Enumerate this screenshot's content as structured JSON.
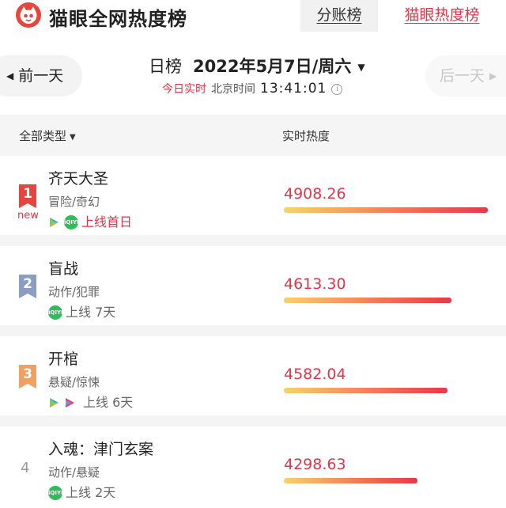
{
  "header": {
    "brand": "猫眼全网热度榜",
    "tabs": [
      {
        "label": "分账榜",
        "active": false
      },
      {
        "label": "猫眼热度榜",
        "active": true
      }
    ]
  },
  "date_nav": {
    "prev_label": "前一天",
    "next_label": "后一天",
    "board_label": "日榜",
    "date": "2022年5月7日/周六",
    "live_label": "今日实时",
    "tz_label": "北京时间",
    "time": "13:41:01"
  },
  "columns": {
    "type_filter": "全部类型",
    "heat_label": "实时热度"
  },
  "colors": {
    "accent": "#e3354b",
    "bar_start": "#f7d36a",
    "bar_end": "#e5394b",
    "iqiyi_green": "#2fbd5a"
  },
  "rows": [
    {
      "rank": "1",
      "badge": "new",
      "title": "齐天大圣",
      "genre": "冒险/奇幻",
      "release": "上线首日",
      "heat": "4908.26",
      "heat_value": 4908.26,
      "platforms": [
        "tencent-video-icon",
        "iqiyi-icon"
      ]
    },
    {
      "rank": "2",
      "title": "盲战",
      "genre": "动作/犯罪",
      "release": "上线 7天",
      "heat": "4613.30",
      "heat_value": 4613.3,
      "platforms": [
        "iqiyi-icon"
      ]
    },
    {
      "rank": "3",
      "title": "开棺",
      "genre": "悬疑/惊悚",
      "release": "上线 6天",
      "heat": "4582.04",
      "heat_value": 4582.04,
      "platforms": [
        "tencent-video-icon",
        "youku-icon"
      ]
    },
    {
      "rank": "4",
      "title": "入魂：津门玄案",
      "genre": "动作/悬疑",
      "release": "上线 2天",
      "heat": "4298.63",
      "heat_value": 4298.63,
      "platforms": [
        "iqiyi-icon"
      ]
    }
  ]
}
